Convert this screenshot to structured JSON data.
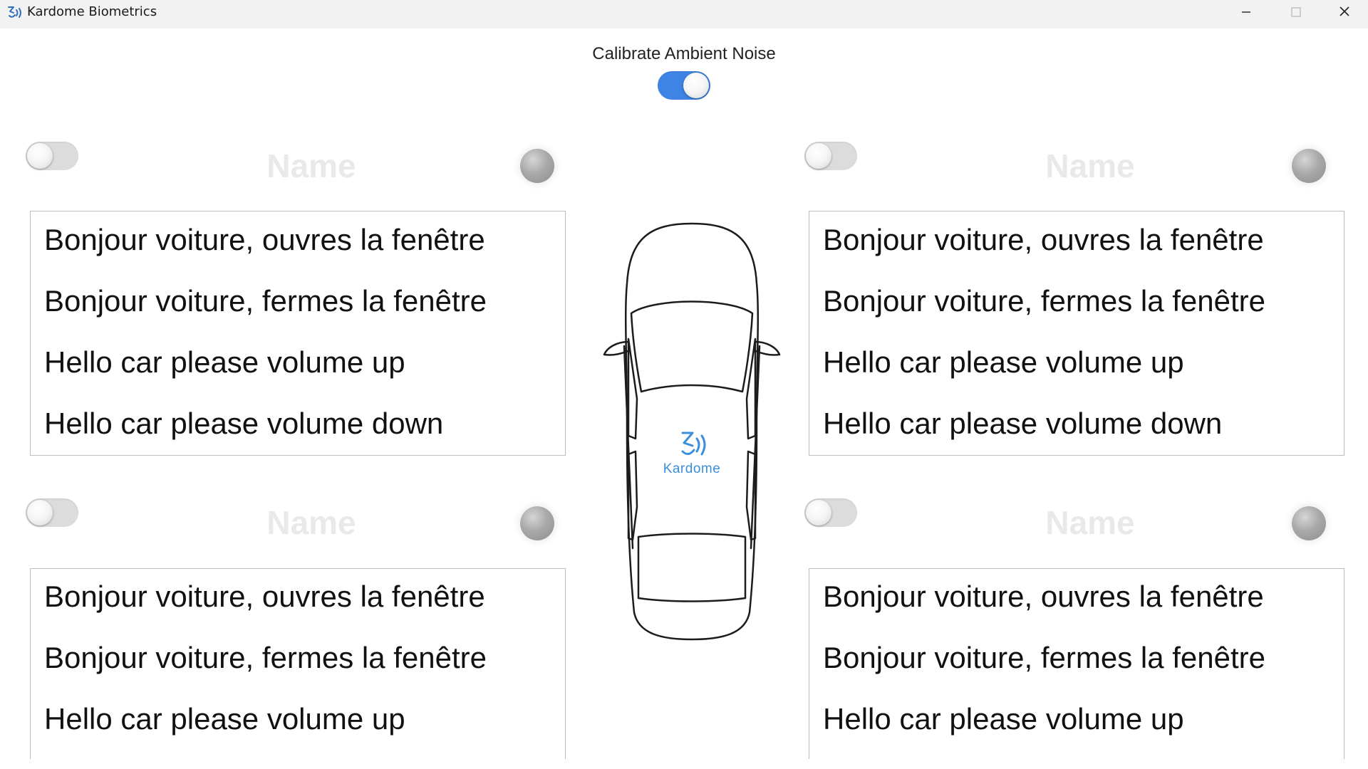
{
  "window": {
    "title": "Kardome Biometrics"
  },
  "calibrate": {
    "label": "Calibrate Ambient Noise",
    "enabled": true,
    "accent_color": "#3e84e4"
  },
  "car": {
    "logo_text": "Kardome",
    "logo_color": "#3a8fdc"
  },
  "seats": [
    {
      "name_placeholder": "Name",
      "toggle_on": false,
      "phrases": [
        "Bonjour voiture, ouvres la fenêtre",
        "Bonjour voiture, fermes la fenêtre",
        "Hello car please volume up",
        "Hello car please volume down"
      ]
    },
    {
      "name_placeholder": "Name",
      "toggle_on": false,
      "phrases": [
        "Bonjour voiture, ouvres la fenêtre",
        "Bonjour voiture, fermes la fenêtre",
        "Hello car please volume up",
        "Hello car please volume down"
      ]
    },
    {
      "name_placeholder": "Name",
      "toggle_on": false,
      "phrases": [
        "Bonjour voiture, ouvres la fenêtre",
        "Bonjour voiture, fermes la fenêtre",
        "Hello car please volume up"
      ]
    },
    {
      "name_placeholder": "Name",
      "toggle_on": false,
      "phrases": [
        "Bonjour voiture, ouvres la fenêtre",
        "Bonjour voiture, fermes la fenêtre",
        "Hello car please volume up"
      ]
    }
  ]
}
